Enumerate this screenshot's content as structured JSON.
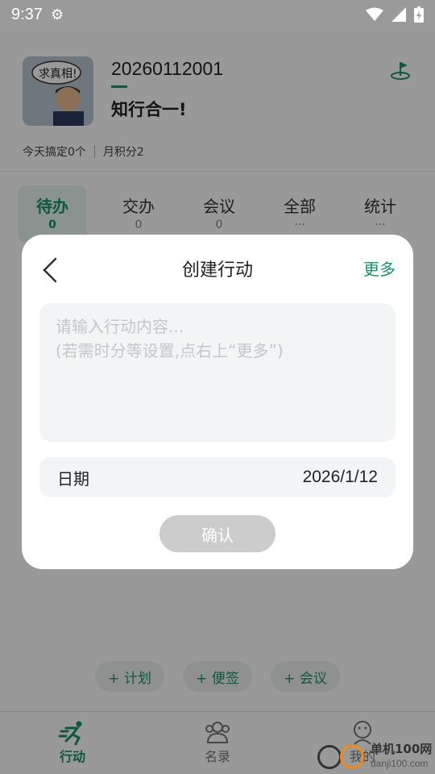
{
  "status_bar": {
    "time": "9:37"
  },
  "profile": {
    "account_id": "20260112001",
    "motto": "知行合一!",
    "stat_today": "今天搞定0个",
    "stat_month": "月积分2",
    "avatar_text": "求真相!"
  },
  "tabs": [
    {
      "label": "待办",
      "count": "0"
    },
    {
      "label": "交办",
      "count": "0"
    },
    {
      "label": "会议",
      "count": "0"
    },
    {
      "label": "全部",
      "count": "···"
    },
    {
      "label": "统计",
      "count": "···"
    }
  ],
  "quick_actions": [
    "+ 计划",
    "+ 便签",
    "+ 会议"
  ],
  "bottom_nav": [
    "行动",
    "名录",
    "我的"
  ],
  "dialog": {
    "title": "创建行动",
    "more": "更多",
    "placeholder": "请输入行动内容...\n(若需时分等设置,点右上“更多”)",
    "date_label": "日期",
    "date_value": "2026/1/12",
    "confirm": "确认"
  },
  "watermark": {
    "line1": "单机100网",
    "line2": "danji100.com"
  },
  "colors": {
    "accent": "#18936c",
    "overlay": "rgba(0,0,0,0.40)",
    "confirm_disabled": "#cccccc"
  }
}
